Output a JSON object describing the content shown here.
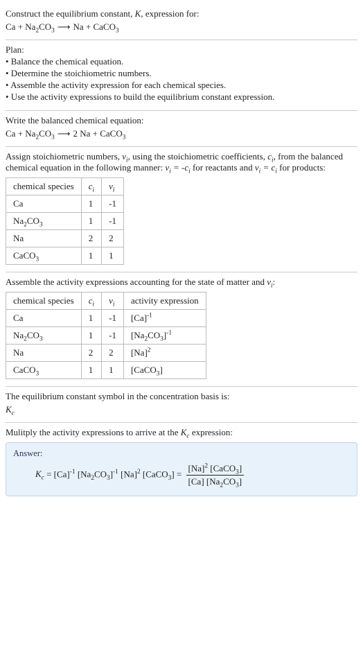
{
  "header": {
    "prompt_a": "Construct the equilibrium constant, ",
    "prompt_b": ", expression for:"
  },
  "plan": {
    "title": "Plan:",
    "items": [
      "• Balance the chemical equation.",
      "• Determine the stoichiometric numbers.",
      "• Assemble the activity expression for each chemical species.",
      "• Use the activity expressions to build the equilibrium constant expression."
    ]
  },
  "balance": {
    "title": "Write the balanced chemical equation:"
  },
  "stoich": {
    "intro_a": "Assign stoichiometric numbers, ",
    "intro_b": ", using the stoichiometric coefficients, ",
    "intro_c": ", from the balanced chemical equation in the following manner: ",
    "intro_d": " for reactants and ",
    "intro_e": " for products:",
    "headers": {
      "species": "chemical species"
    },
    "rows": [
      {
        "species": "Ca",
        "c": "1",
        "v": "-1"
      },
      {
        "species": "Na₂CO₃",
        "c": "1",
        "v": "-1"
      },
      {
        "species": "Na",
        "c": "2",
        "v": "2"
      },
      {
        "species": "CaCO₃",
        "c": "1",
        "v": "1"
      }
    ]
  },
  "activity": {
    "intro_a": "Assemble the activity expressions accounting for the state of matter and ",
    "intro_b": ":",
    "headers": {
      "species": "chemical species",
      "act": "activity expression"
    },
    "rows": [
      {
        "species": "Ca",
        "c": "1",
        "v": "-1"
      },
      {
        "species": "Na₂CO₃",
        "c": "1",
        "v": "-1"
      },
      {
        "species": "Na",
        "c": "2",
        "v": "2"
      },
      {
        "species": "CaCO₃",
        "c": "1",
        "v": "1"
      }
    ]
  },
  "ksymbol": {
    "text": "The equilibrium constant symbol in the concentration basis is:"
  },
  "multiply": {
    "text_a": "Mulitply the activity expressions to arrive at the ",
    "text_b": " expression:"
  },
  "answer": {
    "label": "Answer:"
  },
  "chart_data": {
    "type": "table",
    "tables": [
      {
        "title": "stoichiometric numbers",
        "columns": [
          "chemical species",
          "c_i",
          "v_i"
        ],
        "rows": [
          [
            "Ca",
            1,
            -1
          ],
          [
            "Na2CO3",
            1,
            -1
          ],
          [
            "Na",
            2,
            2
          ],
          [
            "CaCO3",
            1,
            1
          ]
        ]
      },
      {
        "title": "activity expressions",
        "columns": [
          "chemical species",
          "c_i",
          "v_i",
          "activity expression"
        ],
        "rows": [
          [
            "Ca",
            1,
            -1,
            "[Ca]^-1"
          ],
          [
            "Na2CO3",
            1,
            -1,
            "[Na2CO3]^-1"
          ],
          [
            "Na",
            2,
            2,
            "[Na]^2"
          ],
          [
            "CaCO3",
            1,
            1,
            "[CaCO3]"
          ]
        ]
      }
    ],
    "unbalanced_equation": "Ca + Na2CO3 -> Na + CaCO3",
    "balanced_equation": "Ca + Na2CO3 -> 2 Na + CaCO3",
    "Kc_expression": "Kc = [Na]^2 [CaCO3] / ( [Ca] [Na2CO3] )"
  }
}
